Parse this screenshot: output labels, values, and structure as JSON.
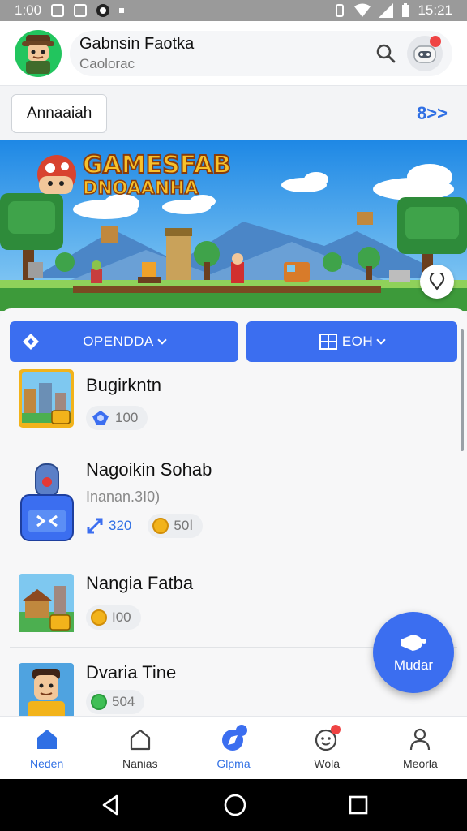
{
  "status_bar": {
    "time_left": "1:00",
    "time_right": "15:21"
  },
  "header": {
    "title": "Gabnsin Faotka",
    "subtitle": "Caolorac",
    "avatar_icon": "character-avatar-icon",
    "search_icon": "search-icon",
    "robot_icon": "robot-face-icon"
  },
  "subbar": {
    "button_label": "Annaaiah",
    "link_label": "8>>"
  },
  "banner": {
    "title_line1": "GAMESFAB",
    "title_line2": "DNOAANHA",
    "location_icon": "map-pin-icon"
  },
  "filters": {
    "left_label": "OPENDDA",
    "right_label": "EOH",
    "left_icon": "diamond-icon",
    "right_icon": "grid-icon"
  },
  "items": [
    {
      "name": "Bugirkntn",
      "subtitle": "",
      "pills": [
        {
          "icon": "pixel-badge-icon",
          "value": "100"
        }
      ]
    },
    {
      "name": "Nagoikin Sohab",
      "subtitle": "Inanan.3I0)",
      "pills": [
        {
          "icon": "arrows-icon",
          "value": "320"
        },
        {
          "icon": "gold-coin-icon",
          "value": "50Ⅰ"
        }
      ]
    },
    {
      "name": "Nangia Fatba",
      "subtitle": "",
      "pills": [
        {
          "icon": "gold-coin-icon",
          "value": "I00"
        }
      ]
    },
    {
      "name": "Dvaria Tine",
      "subtitle": "",
      "pills": [
        {
          "icon": "green-coin-icon",
          "value": "504"
        }
      ]
    }
  ],
  "fab": {
    "label": "Mudar",
    "icon": "megaphone-icon"
  },
  "bottom_nav": [
    {
      "label": "Neden",
      "icon": "home-icon",
      "active": true
    },
    {
      "label": "Nanias",
      "icon": "house-outline-icon",
      "active": false
    },
    {
      "label": "Glpma",
      "icon": "compass-icon",
      "active": false
    },
    {
      "label": "Wola",
      "icon": "emoji-icon",
      "active": false
    },
    {
      "label": "Meorla",
      "icon": "person-icon",
      "active": false
    }
  ],
  "colors": {
    "accent": "#3b6ef0",
    "badge": "#ef4444",
    "avatar_bg": "#22c55e"
  }
}
